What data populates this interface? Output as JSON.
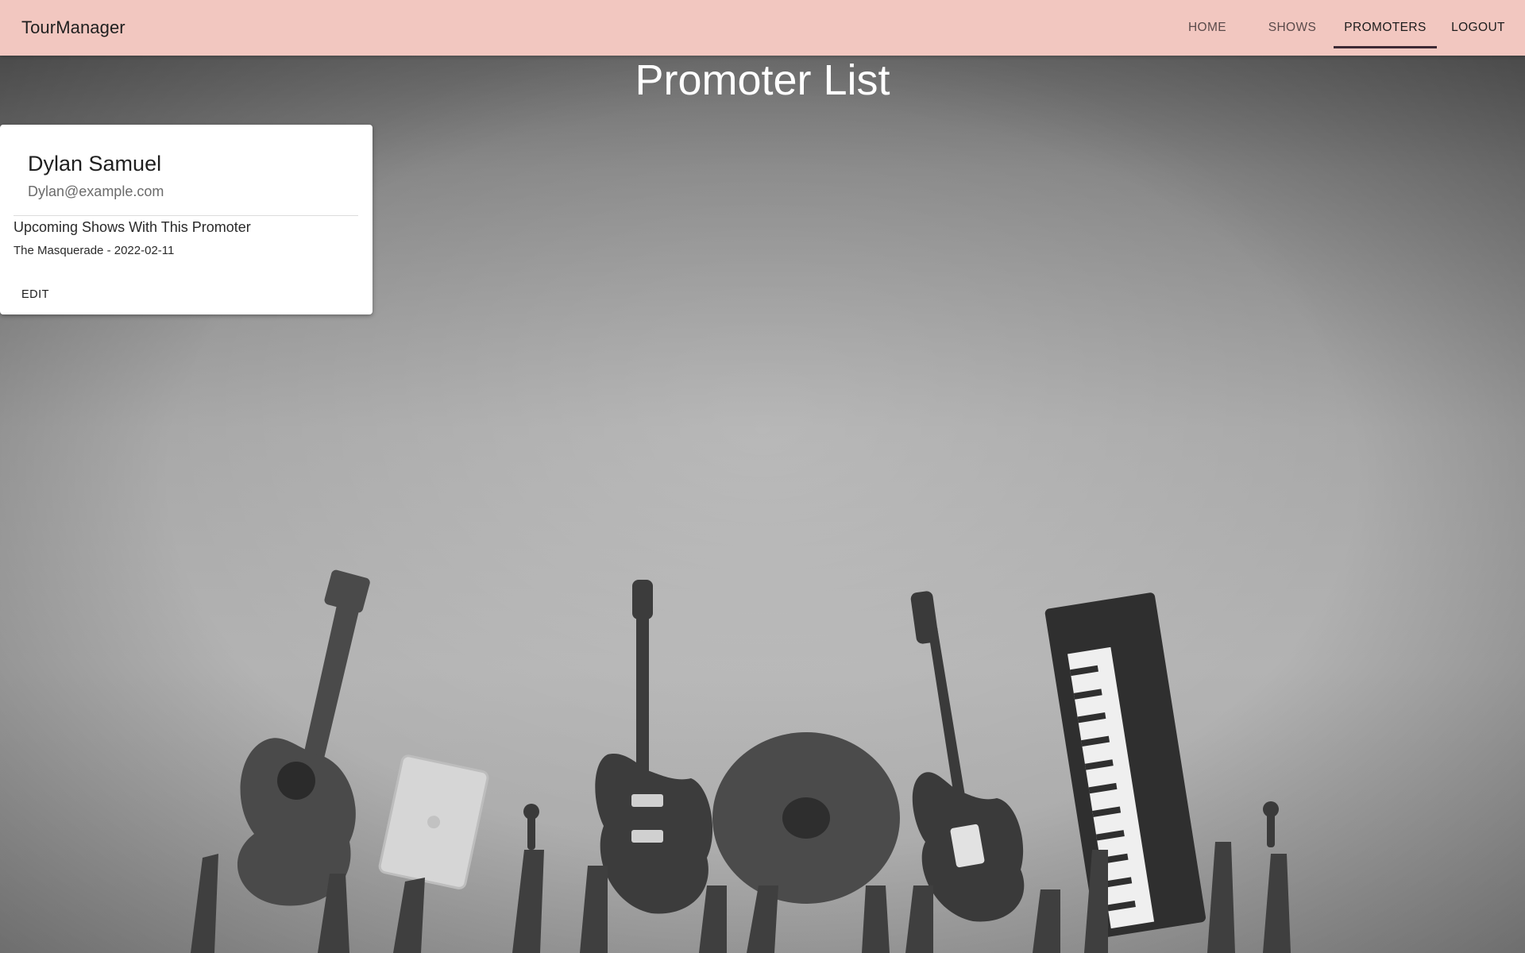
{
  "app": {
    "brand": "TourManager"
  },
  "nav": {
    "items": [
      {
        "label": "HOME",
        "active": false
      },
      {
        "label": "SHOWS",
        "active": false
      },
      {
        "label": "PROMOTERS",
        "active": true
      },
      {
        "label": "LOGOUT",
        "active": false
      }
    ]
  },
  "page": {
    "title": "Promoter List"
  },
  "promoters": [
    {
      "name": "Dylan Samuel",
      "email": "Dylan@example.com",
      "shows_heading": "Upcoming Shows With This Promoter",
      "shows": [
        "The Masquerade - 2022-02-11"
      ],
      "edit_label": "EDIT"
    }
  ],
  "colors": {
    "appbar_bg": "#f2c7c0",
    "active_indicator": "#3d2a35",
    "title_text": "#ffffff",
    "card_bg": "#ffffff"
  }
}
